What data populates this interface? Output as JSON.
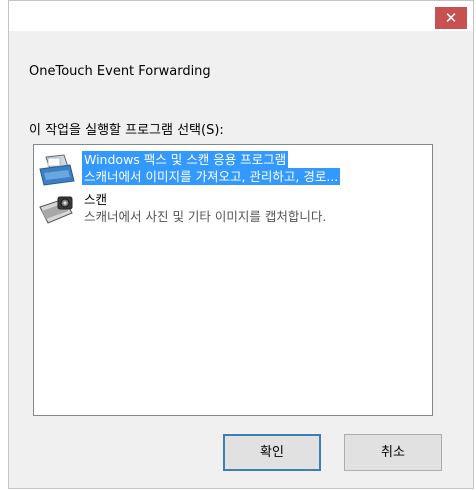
{
  "titlebar": {
    "close_glyph": "✕"
  },
  "dialog": {
    "app_name": "OneTouch Event Forwarding",
    "prompt": "이 작업을 실행할 프로그램 선택(S):"
  },
  "programs": [
    {
      "name": "Windows 팩스 및 스캔 응용 프로그램",
      "description": "스캐너에서 이미지를 가져오고, 관리하고, 경로...",
      "icon": "fax-scanner-icon",
      "selected": true
    },
    {
      "name": "스캔",
      "description": "스캐너에서 사진 및 기타 이미지를 캡처합니다.",
      "icon": "camera-scanner-icon",
      "selected": false
    }
  ],
  "buttons": {
    "ok": "확인",
    "cancel": "취소"
  },
  "colors": {
    "selection": "#3399ff",
    "close": "#c75050",
    "default_border": "#3c7fb1"
  }
}
